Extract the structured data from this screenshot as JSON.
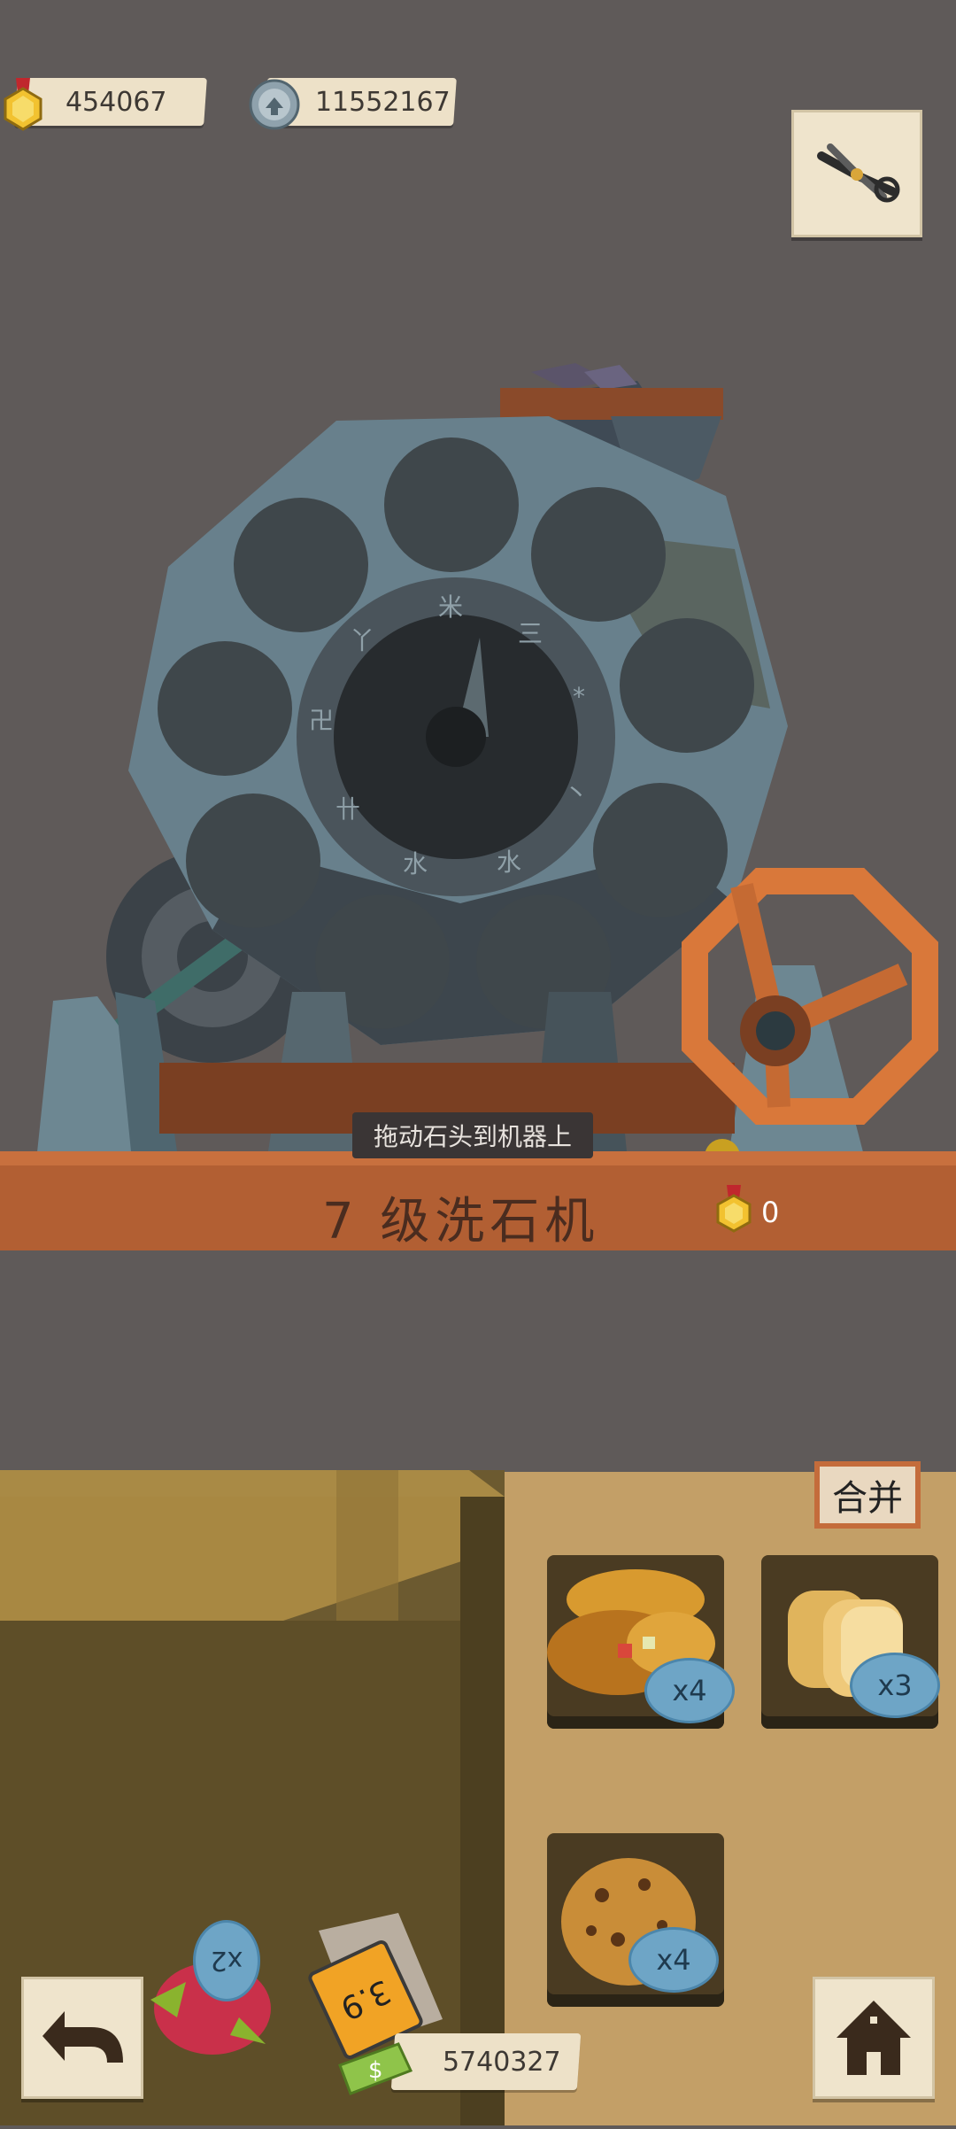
{
  "hud": {
    "medals": "454067",
    "gears": "11552167",
    "money": "5740327"
  },
  "machine": {
    "hint": "拖动石头到机器上",
    "title": "7 级洗石机",
    "reward": "0",
    "dial_chars": [
      "米",
      "三",
      "*",
      "丶",
      "水",
      "水",
      "卄",
      "卍",
      "丫"
    ]
  },
  "panel": {
    "merge_label": "合并"
  },
  "items": [
    {
      "name": "pastries",
      "badge": "x4"
    },
    {
      "name": "bread",
      "badge": "x3"
    },
    {
      "name": "cookie",
      "badge": "x4"
    }
  ],
  "ground_items": [
    {
      "name": "dragonfruit",
      "badge": "x2"
    },
    {
      "name": "tag",
      "badge": "3.9"
    }
  ],
  "colors": {
    "background": "#5f5a59",
    "wood": "#b25f33",
    "paper": "#ede1c8",
    "badge": "#6ea5c6",
    "wheel": "#d9783a"
  }
}
